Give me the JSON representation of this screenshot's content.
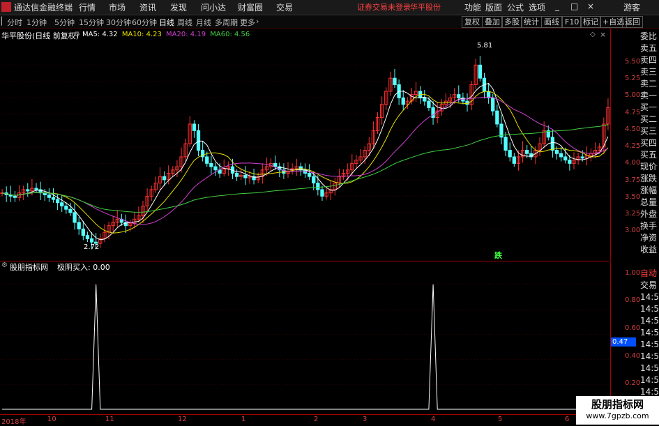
{
  "app": {
    "title": "通达信金融终端",
    "menu": [
      "行情",
      "市场",
      "资讯",
      "发现",
      "问小达",
      "财富圈",
      "交易"
    ],
    "login_status": "证券交易未登录",
    "stock_name_top": "华平股份",
    "right_menu": [
      "功能",
      "版面",
      "公式",
      "选项"
    ],
    "user": "游客",
    "window_controls": [
      "_",
      "□",
      "×"
    ]
  },
  "periods": [
    "分时",
    "1分钟",
    "5分钟",
    "15分钟",
    "30分钟",
    "60分钟",
    "日线",
    "周线",
    "月线",
    "多周期",
    "更多"
  ],
  "active_period": "日线",
  "tools": [
    "复权",
    "叠加",
    "多股",
    "统计",
    "画线",
    "F10",
    "标记",
    "+自选",
    "返回"
  ],
  "main": {
    "title": "华平股份(日线 前复权)",
    "ma": [
      {
        "label": "MA5: 4.32",
        "color": "#ffffff"
      },
      {
        "label": "MA10: 4.23",
        "color": "#e8e000"
      },
      {
        "label": "MA20: 4.19",
        "color": "#d040d0"
      },
      {
        "label": "MA60: 4.56",
        "color": "#40d040"
      }
    ],
    "y_ticks": [
      "5.50",
      "5.25",
      "5.00",
      "4.75",
      "4.50",
      "4.25",
      "4.00",
      "3.75",
      "3.50",
      "3.25",
      "3.00"
    ],
    "high_label": "5.81",
    "low_label": "2.72",
    "event_label": "跌"
  },
  "sub": {
    "title": "股朋指标网",
    "indicator": "极阴买入: 0.00",
    "y_ticks": [
      "1.00",
      "0.80",
      "0.60",
      "0.40",
      "0.20"
    ],
    "current_value": "0.47"
  },
  "side_panel": [
    "委比",
    "卖五",
    "卖四",
    "卖三",
    "卖二",
    "卖一",
    "买一",
    "买二",
    "买三",
    "买四",
    "买五",
    "现价",
    "涨跌",
    "涨幅",
    "总量",
    "外盘",
    "换手",
    "净资",
    "收益"
  ],
  "side_panel_lower": [
    "自动",
    "交易",
    "14:56",
    "14:56",
    "14:56",
    "14:56",
    "14:56",
    "14:56",
    "14:56",
    "14:56",
    "14:56",
    "14:56"
  ],
  "date_axis": [
    "2018年",
    "10",
    "11",
    "12",
    "1",
    "2",
    "3",
    "4",
    "5",
    "6"
  ],
  "watermark": "股朋指标网",
  "watermark_url": "www.7gpzb.com",
  "colors": {
    "up": "#ff3232",
    "down": "#54ffff",
    "ma5": "#ffffff",
    "ma10": "#e8e000",
    "ma20": "#d040d0",
    "ma60": "#40d040",
    "axis": "#a00000"
  },
  "chart_data": {
    "type": "candlestick",
    "y_range": [
      2.6,
      5.95
    ],
    "sub_type": "line",
    "sub_values_spikes": [
      {
        "index": 22,
        "value": 1.0
      },
      {
        "index": 101,
        "value": 1.0
      }
    ],
    "sub_y_range": [
      0,
      1.1
    ],
    "closes": [
      3.55,
      3.52,
      3.5,
      3.48,
      3.55,
      3.6,
      3.58,
      3.62,
      3.6,
      3.55,
      3.52,
      3.48,
      3.45,
      3.4,
      3.35,
      3.3,
      3.25,
      3.1,
      3.0,
      2.9,
      2.85,
      2.8,
      2.78,
      2.85,
      2.95,
      3.05,
      3.1,
      3.15,
      3.1,
      3.05,
      3.08,
      3.15,
      3.2,
      3.35,
      3.5,
      3.6,
      3.7,
      3.8,
      3.75,
      3.85,
      3.9,
      3.95,
      4.1,
      4.3,
      4.6,
      4.5,
      4.2,
      4.1,
      4.0,
      3.95,
      3.9,
      3.85,
      3.92,
      3.95,
      3.85,
      3.8,
      3.82,
      3.78,
      3.8,
      3.75,
      3.8,
      3.9,
      3.95,
      4.0,
      3.95,
      3.9,
      3.85,
      3.88,
      3.92,
      3.95,
      3.9,
      3.85,
      3.8,
      3.7,
      3.6,
      3.5,
      3.55,
      3.6,
      3.7,
      3.8,
      3.85,
      3.9,
      4.0,
      4.05,
      4.1,
      4.2,
      4.3,
      4.5,
      4.7,
      4.9,
      5.1,
      5.3,
      5.2,
      5.0,
      4.9,
      4.95,
      5.05,
      5.1,
      5.0,
      4.95,
      4.85,
      4.7,
      4.8,
      4.9,
      4.95,
      5.0,
      5.05,
      5.0,
      4.95,
      4.9,
      5.2,
      5.5,
      5.3,
      5.1,
      5.0,
      4.8,
      4.6,
      4.4,
      4.2,
      4.1,
      4.0,
      4.1,
      4.2,
      4.15,
      4.1,
      4.2,
      4.3,
      4.5,
      4.4,
      4.2,
      4.15,
      4.1,
      4.05,
      4.0,
      4.05,
      4.1,
      4.08,
      4.12,
      4.15,
      4.2,
      4.25,
      4.6,
      4.85
    ]
  }
}
